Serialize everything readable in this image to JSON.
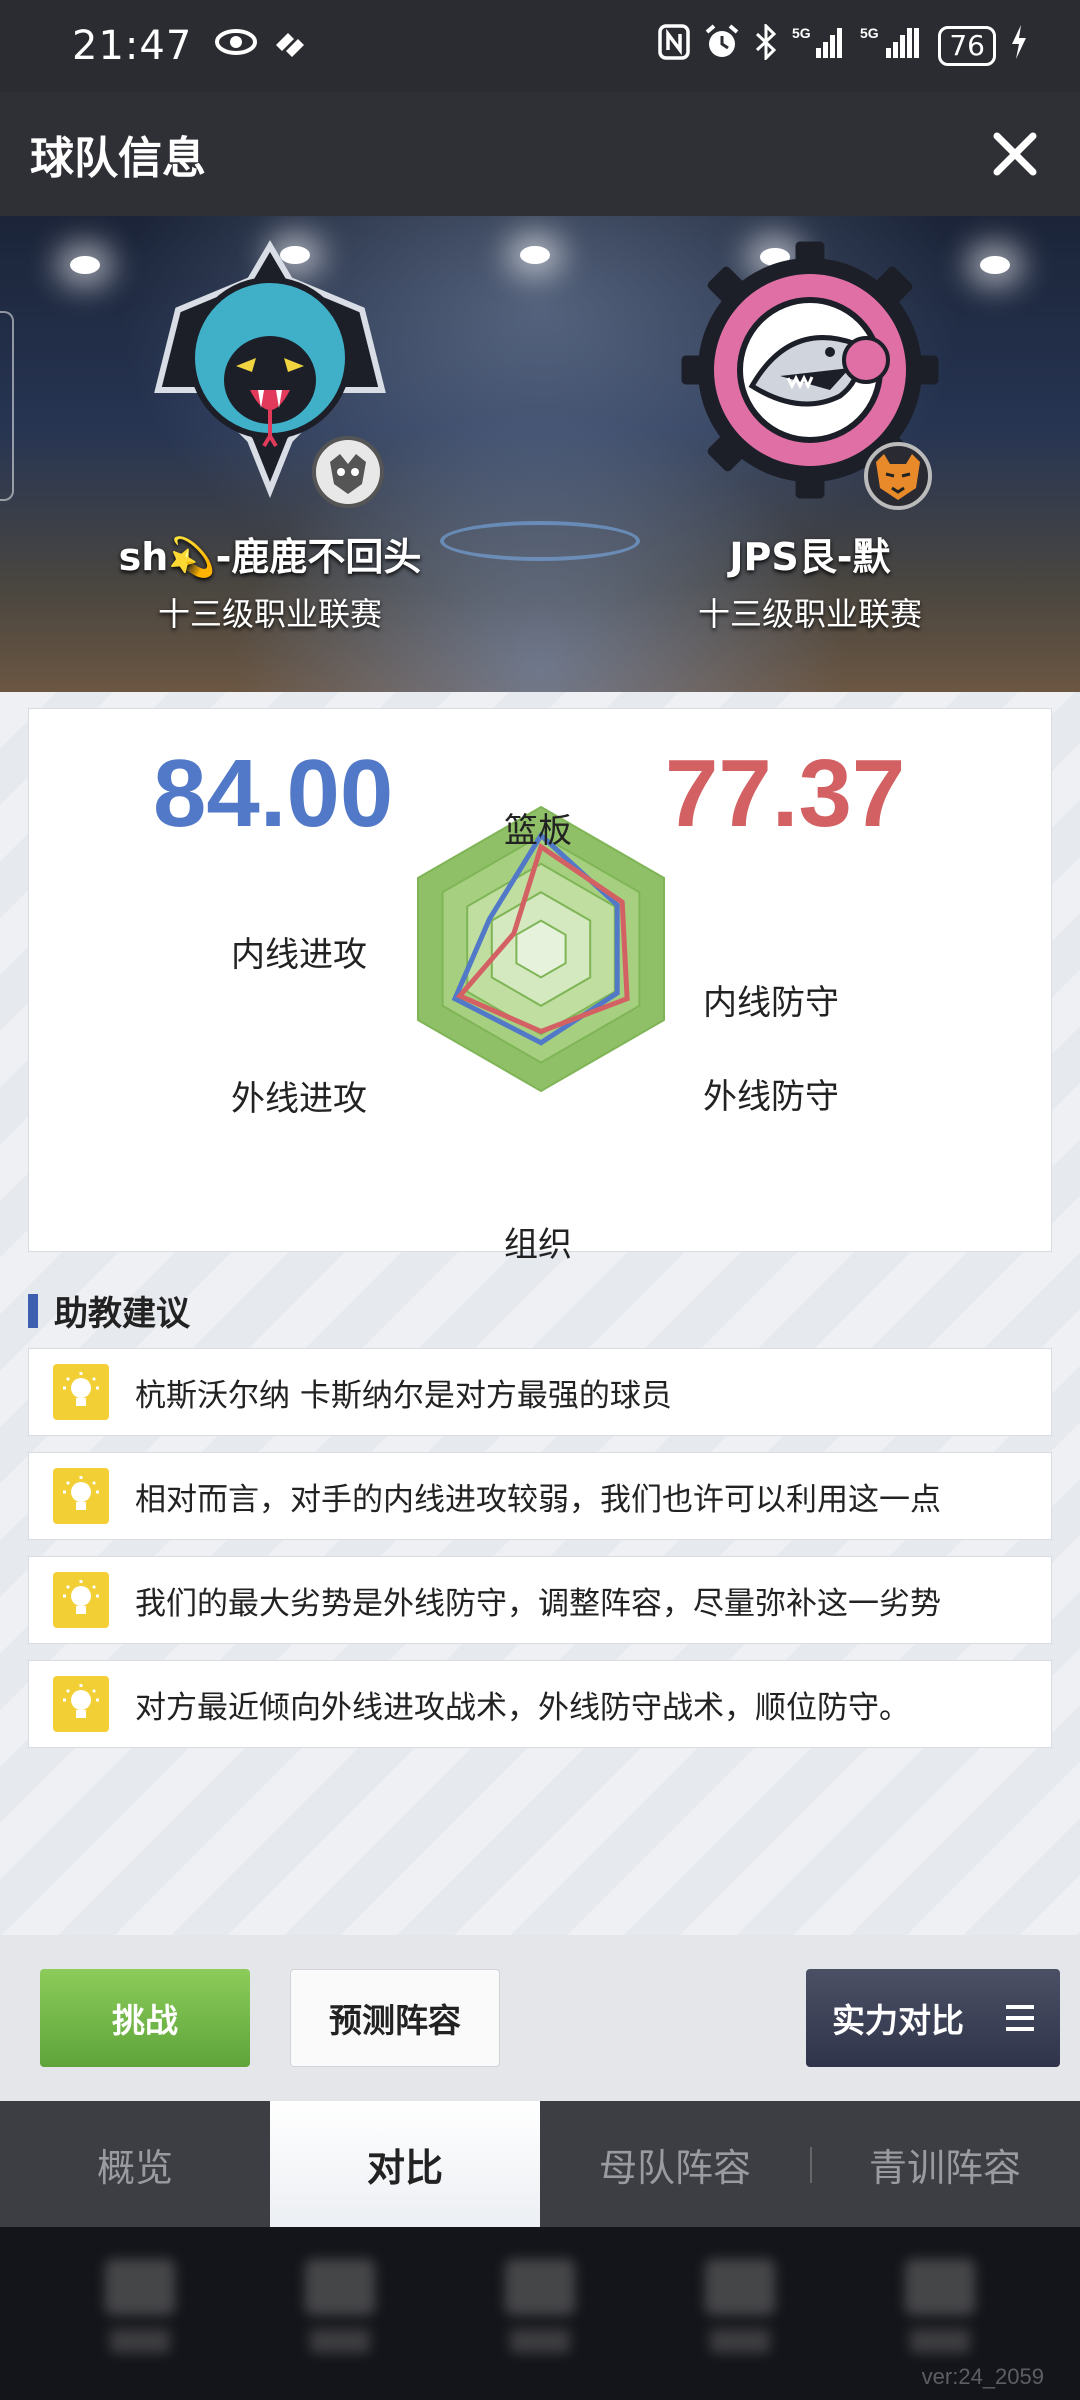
{
  "status_bar": {
    "time": "21:47",
    "left_icons": [
      "eye-icon",
      "app-icon"
    ],
    "right_icons": [
      "nfc-icon",
      "alarm-icon",
      "bluetooth-icon",
      "signal-5g-icon",
      "signal-5g-icon"
    ],
    "battery": "76"
  },
  "header": {
    "title": "球队信息",
    "close_icon": "close-icon"
  },
  "teams": {
    "left": {
      "name": "sh💫-鹿鹿不回头",
      "league": "十三级职业联赛",
      "logo": "snake-logo"
    },
    "right": {
      "name": "JPS艮-默",
      "league": "十三级职业联赛",
      "logo": "shark-logo"
    }
  },
  "comparison": {
    "left_score": "84.00",
    "right_score": "77.37",
    "left_color": "#5279c8",
    "right_color": "#d36163",
    "axes": [
      "篮板",
      "内线防守",
      "外线防守",
      "组织",
      "外线进攻",
      "内线进攻"
    ],
    "left_values": [
      0.8,
      0.62,
      0.62,
      0.66,
      0.7,
      0.42
    ],
    "right_values": [
      0.72,
      0.66,
      0.7,
      0.58,
      0.66,
      0.22
    ]
  },
  "advice": {
    "title": "助教建议",
    "items": [
      "杭斯沃尔纳 卡斯纳尔是对方最强的球员",
      "相对而言，对手的内线进攻较弱，我们也许可以利用这一点",
      "我们的最大劣势是外线防守，调整阵容，尽量弥补这一劣势",
      "对方最近倾向外线进攻战术，外线防守战术，顺位防守。"
    ]
  },
  "actions": {
    "challenge": "挑战",
    "predict": "预测阵容",
    "strength": "实力对比",
    "strength_icon": "menu-icon"
  },
  "tabs": [
    "概览",
    "对比",
    "母队阵容",
    "青训阵容"
  ],
  "active_tab": 1,
  "version": "ver:24_2059"
}
